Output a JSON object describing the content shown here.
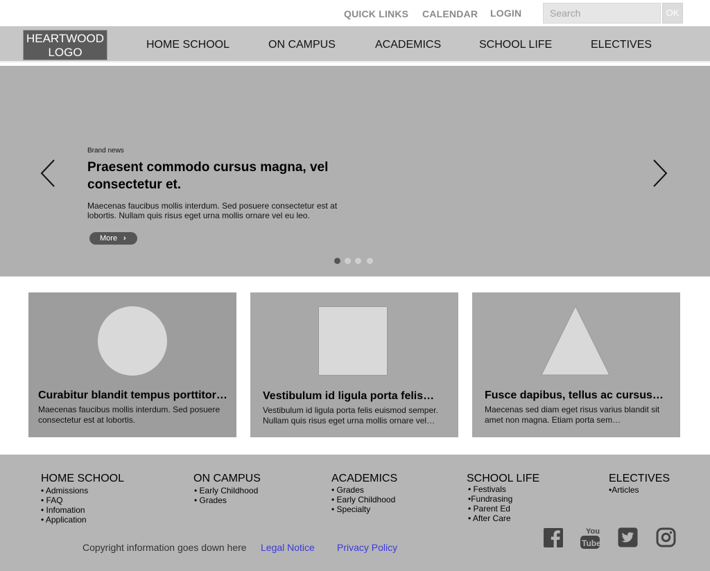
{
  "utility": {
    "links": [
      "QUICK LINKS",
      "CALENDAR",
      "LOGIN"
    ],
    "search_placeholder": "Search",
    "ok_label": "OK"
  },
  "nav": {
    "logo_line1": "HEARTWOOD",
    "logo_line2": "LOGO",
    "items": [
      "HOME SCHOOL",
      "ON CAMPUS",
      "ACADEMICS",
      "SCHOOL LIFE",
      "ELECTIVES"
    ]
  },
  "hero": {
    "kicker": "Brand news",
    "title": "Praesent commodo cursus magna, vel consectetur et.",
    "text": "Maecenas faucibus mollis interdum. Sed posuere consectetur est at lobortis. Nullam quis risus eget urna mollis ornare vel eu leo.",
    "more_label": "More",
    "more_chevron": "›",
    "slide_count": 4,
    "active_slide": 1,
    "icons": {
      "prev": "chevron-left-icon",
      "next": "chevron-right-icon"
    }
  },
  "cards": [
    {
      "shape": "circle",
      "title": "Curabitur blandit tempus porttitor…",
      "text": "Maecenas faucibus mollis interdum. Sed posuere consectetur est at lobortis."
    },
    {
      "shape": "square",
      "title": "Vestibulum id ligula porta felis…",
      "text": "Vestibulum id ligula porta felis euismod semper. Nullam quis risus eget urna mollis ornare vel…"
    },
    {
      "shape": "triangle",
      "title": "Fusce dapibus, tellus ac cursus…",
      "text": "Maecenas sed diam eget risus varius blandit sit amet non magna. Etiam porta sem…"
    }
  ],
  "footer": {
    "columns": [
      {
        "heading": "HOME SCHOOL",
        "items": [
          "• Admissions",
          "• FAQ",
          "• Infomation",
          "• Application"
        ]
      },
      {
        "heading": "ON CAMPUS",
        "items": [
          "• Early Childhood",
          "• Grades"
        ]
      },
      {
        "heading": "ACADEMICS",
        "items": [
          "• Grades",
          "• Early Childhood",
          "• Specialty"
        ]
      },
      {
        "heading": "SCHOOL LIFE",
        "items": [
          "• Festivals",
          "•Fundrasing",
          "• Parent Ed",
          "• After Care"
        ]
      },
      {
        "heading": "ELECTIVES",
        "items": [
          "•Articles"
        ]
      }
    ],
    "copyright": "Copyright information goes down here",
    "legal_label": "Legal Notice",
    "privacy_label": "Privacy Policy",
    "social_icons": [
      "facebook-icon",
      "youtube-icon",
      "twitter-icon",
      "instagram-icon"
    ],
    "youtube_you": "You",
    "youtube_tube": "Tube"
  },
  "colors": {
    "hero_bg": "#b0b0b0",
    "nav_bg": "#c6c6c6",
    "footer_bg": "#b5b5b5",
    "link": "#3a3ad6",
    "dot_active": "#555555"
  }
}
